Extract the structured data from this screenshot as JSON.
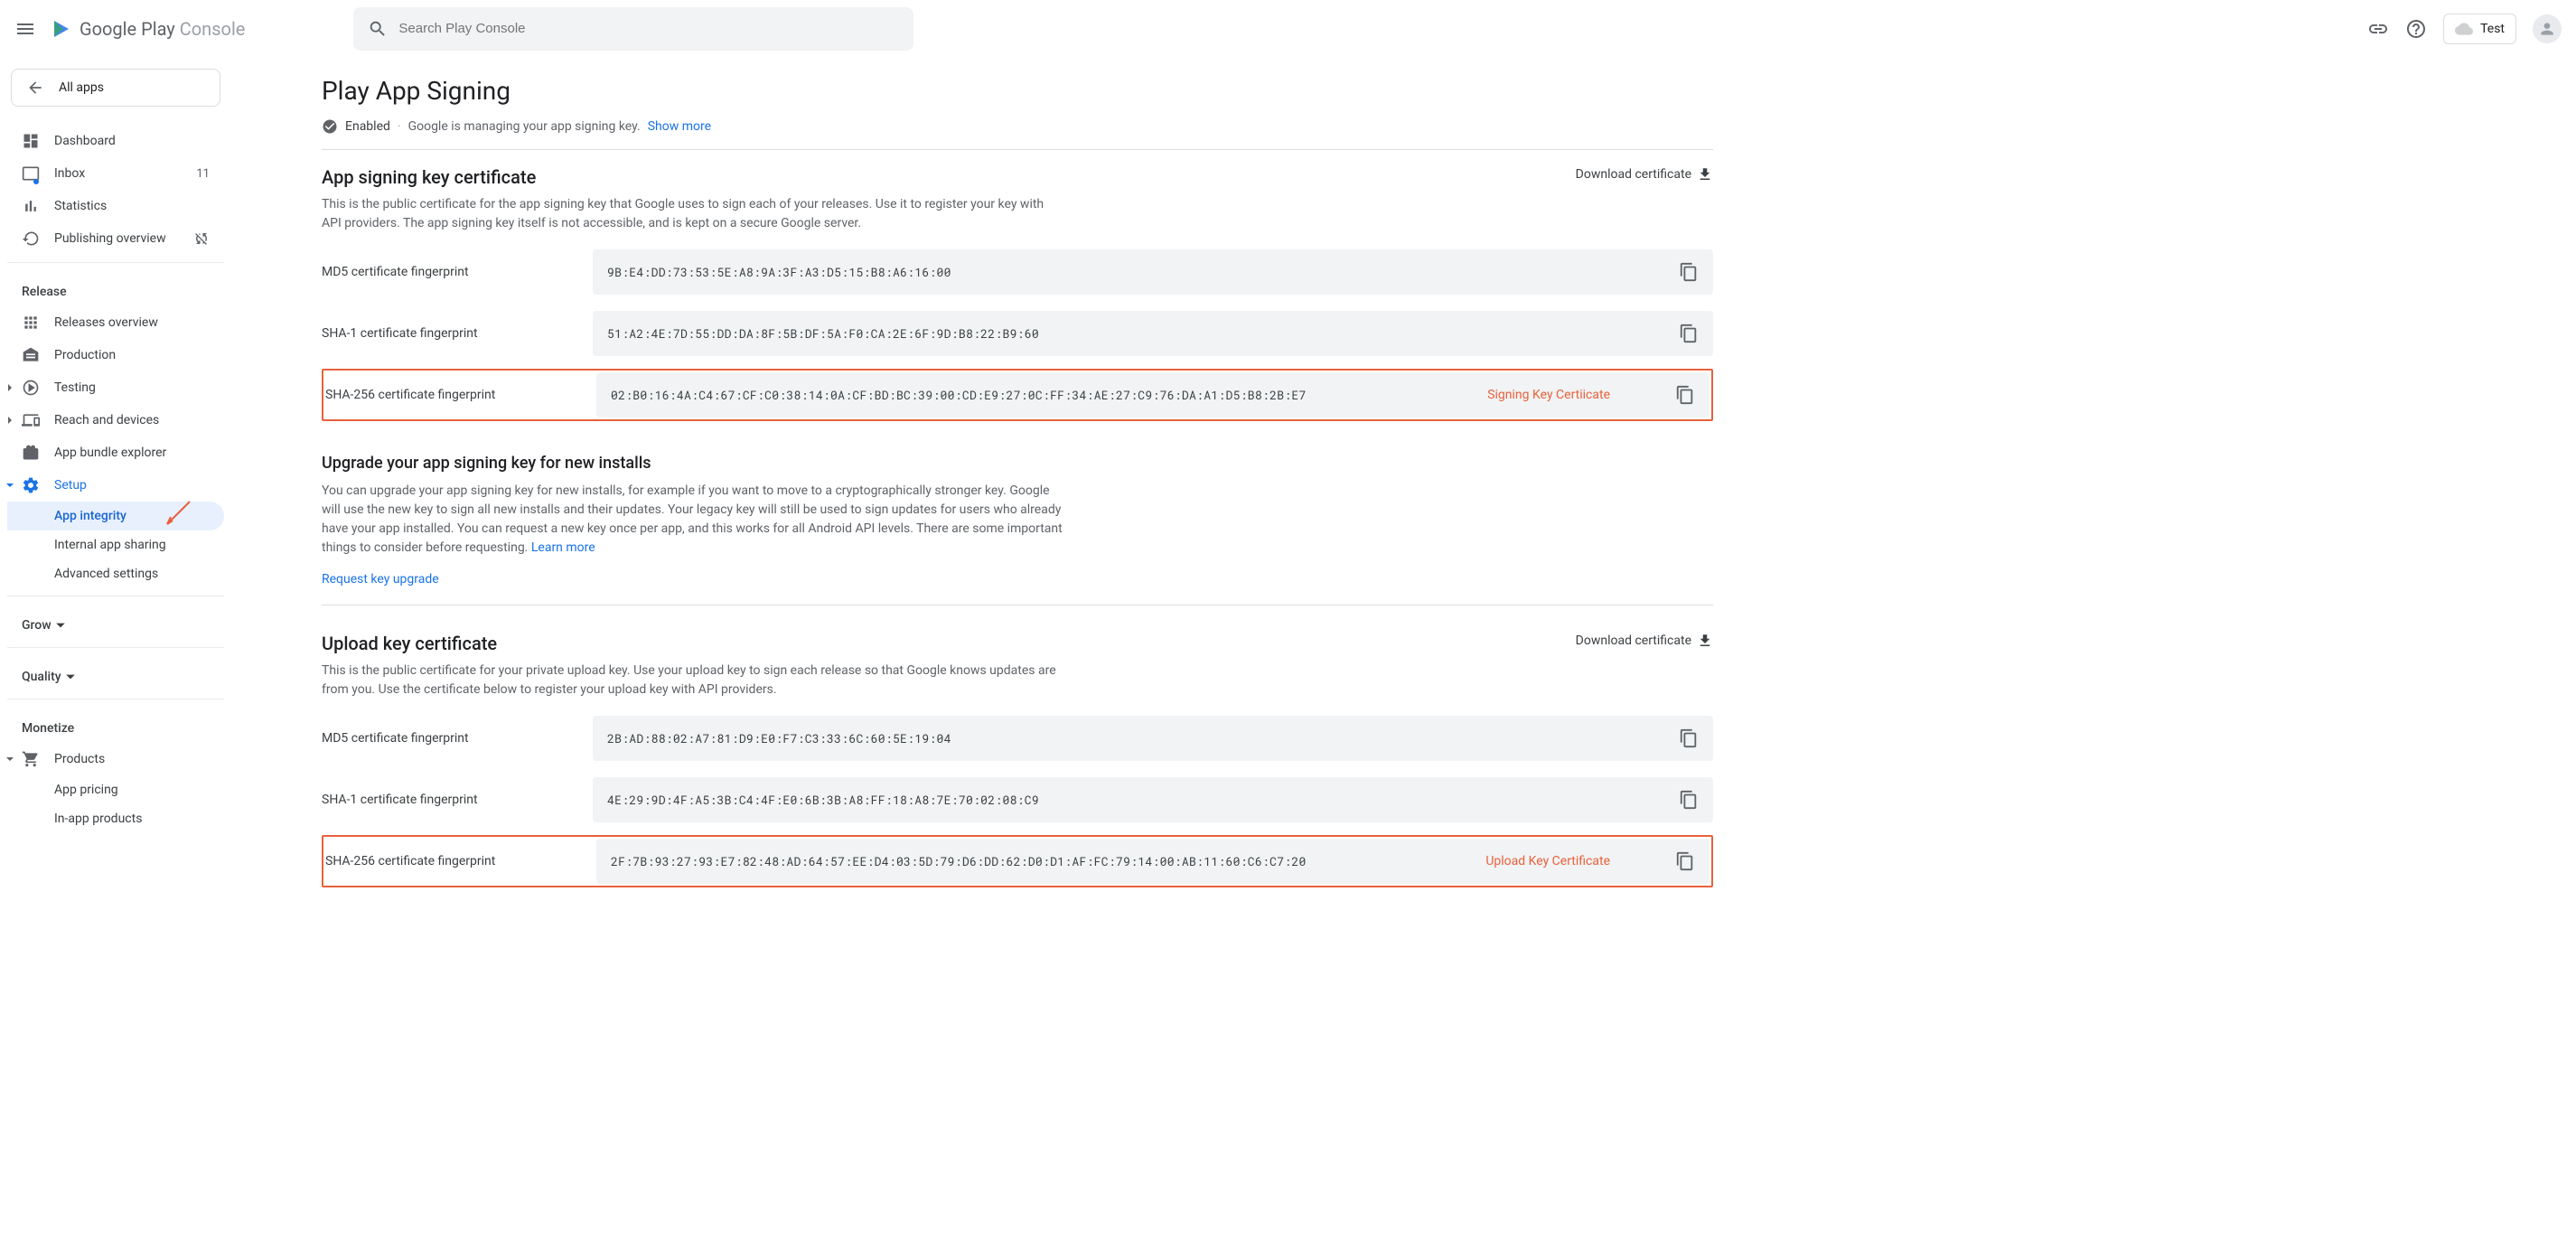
{
  "header": {
    "logo_part1": "Google Play",
    "logo_part2": " Console",
    "search_placeholder": "Search Play Console",
    "dev_name": "Test"
  },
  "sidebar": {
    "all_apps": "All apps",
    "items_top": [
      {
        "label": "Dashboard"
      },
      {
        "label": "Inbox",
        "badge": "11"
      },
      {
        "label": "Statistics"
      },
      {
        "label": "Publishing overview"
      }
    ],
    "release_title": "Release",
    "items_release": [
      {
        "label": "Releases overview"
      },
      {
        "label": "Production"
      },
      {
        "label": "Testing"
      },
      {
        "label": "Reach and devices"
      },
      {
        "label": "App bundle explorer"
      },
      {
        "label": "Setup"
      },
      {
        "label": "App integrity"
      },
      {
        "label": "Internal app sharing"
      },
      {
        "label": "Advanced settings"
      }
    ],
    "grow_title": "Grow",
    "quality_title": "Quality",
    "monetize_title": "Monetize",
    "items_monetize": [
      {
        "label": "Products"
      },
      {
        "label": "App pricing"
      },
      {
        "label": "In-app products"
      }
    ]
  },
  "page": {
    "title": "Play App Signing",
    "enabled": "Enabled",
    "managing": "Google is managing your app signing key.",
    "show_more": "Show more"
  },
  "signing": {
    "title": "App signing key certificate",
    "download": "Download certificate",
    "desc": "This is the public certificate for the app signing key that Google uses to sign each of your releases. Use it to register your key with API providers. The app signing key itself is not accessible, and is kept on a secure Google server.",
    "md5_label": "MD5 certificate fingerprint",
    "md5_value": "9B:E4:DD:73:53:5E:A8:9A:3F:A3:D5:15:B8:A6:16:00",
    "sha1_label": "SHA-1 certificate fingerprint",
    "sha1_value": "51:A2:4E:7D:55:DD:DA:8F:5B:DF:5A:F0:CA:2E:6F:9D:B8:22:B9:60",
    "sha256_label": "SHA-256 certificate fingerprint",
    "sha256_value": "02:B0:16:4A:C4:67:CF:C0:38:14:0A:CF:BD:BC:39:00:CD:E9:27:0C:FF:34:AE:27:C9:76:DA:A1:D5:B8:2B:E7",
    "annotation": "Signing Key Certiicate"
  },
  "upgrade": {
    "title": "Upgrade your app signing key for new installs",
    "desc": "You can upgrade your app signing key for new installs, for example if you want to move to a cryptographically stronger key. Google will use the new key to sign all new installs and their updates. Your legacy key will still be used to sign updates for users who already have your app installed. You can request a new key once per app, and this works for all Android API levels. There are some important things to consider before requesting. ",
    "learn_more": "Learn more",
    "request": "Request key upgrade"
  },
  "upload": {
    "title": "Upload key certificate",
    "download": "Download certificate",
    "desc": "This is the public certificate for your private upload key. Use your upload key to sign each release so that Google knows updates are from you. Use the certificate below to register your upload key with API providers.",
    "md5_label": "MD5 certificate fingerprint",
    "md5_value": "2B:AD:88:02:A7:81:D9:E0:F7:C3:33:6C:60:5E:19:04",
    "sha1_label": "SHA-1 certificate fingerprint",
    "sha1_value": "4E:29:9D:4F:A5:3B:C4:4F:E0:6B:3B:A8:FF:18:A8:7E:70:02:08:C9",
    "sha256_label": "SHA-256 certificate fingerprint",
    "sha256_value": "2F:7B:93:27:93:E7:82:48:AD:64:57:EE:D4:03:5D:79:D6:DD:62:D0:D1:AF:FC:79:14:00:AB:11:60:C6:C7:20",
    "annotation": "Upload Key Certificate"
  }
}
